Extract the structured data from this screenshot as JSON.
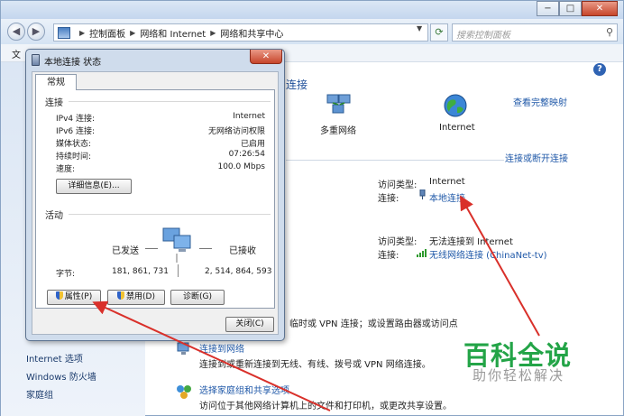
{
  "colors": {
    "accent": "#1f58a8",
    "arrow": "#d9302a",
    "watermark": "#23a447"
  },
  "main_window": {
    "breadcrumbs": [
      "控制面板",
      "网络和 Internet",
      "网络和共享中心"
    ],
    "search_placeholder": "搜索控制面板",
    "menu_label": "文",
    "left_nav": [
      "Internet 选项",
      "Windows 防火墙",
      "家庭组"
    ],
    "content": {
      "title_fragment": "连接",
      "view_full_map": "查看完整映射",
      "node_multi_network": "多重网络",
      "node_internet": "Internet",
      "connect_disconnect": "连接或断开连接",
      "network1": {
        "access_type_label": "访问类型:",
        "access_type_value": "Internet",
        "connection_label": "连接:",
        "connection_value": "本地连接"
      },
      "network2": {
        "access_type_label": "访问类型:",
        "access_type_value": "无法连接到 Internet",
        "connection_label": "连接:",
        "connection_value": "无线网络连接 (ChinaNet-tv)"
      },
      "vpn_text": "临时或 VPN 连接；或设置路由器或访问点",
      "connect_to_network_link": "连接到网络",
      "connect_to_network_desc": "连接到或重新连接到无线、有线、拨号或 VPN 网络连接。",
      "homegroup_link": "选择家庭组和共享选项",
      "homegroup_desc": "访问位于其他网络计算机上的文件和打印机，或更改共享设置。"
    }
  },
  "dialog": {
    "title": "本地连接 状态",
    "close_glyph": "✕",
    "tab_general": "常规",
    "connection": {
      "group_label": "连接",
      "rows": [
        {
          "label": "IPv4 连接:",
          "value": "Internet"
        },
        {
          "label": "IPv6 连接:",
          "value": "无网络访问权限"
        },
        {
          "label": "媒体状态:",
          "value": "已启用"
        },
        {
          "label": "持续时间:",
          "value": "07:26:54"
        },
        {
          "label": "速度:",
          "value": "100.0 Mbps"
        }
      ],
      "details_button": "详细信息(E)..."
    },
    "activity": {
      "group_label": "活动",
      "sent_label": "已发送",
      "received_label": "已接收",
      "bytes_label": "字节:",
      "bytes_sent": "181, 861, 731",
      "bytes_received": "2, 514, 864, 593"
    },
    "buttons": {
      "properties": "属性(P)",
      "disable": "禁用(D)",
      "diagnose": "诊断(G)",
      "close": "关闭(C)"
    }
  },
  "watermark": {
    "main": "百科全说",
    "sub": "助你轻松解决"
  }
}
